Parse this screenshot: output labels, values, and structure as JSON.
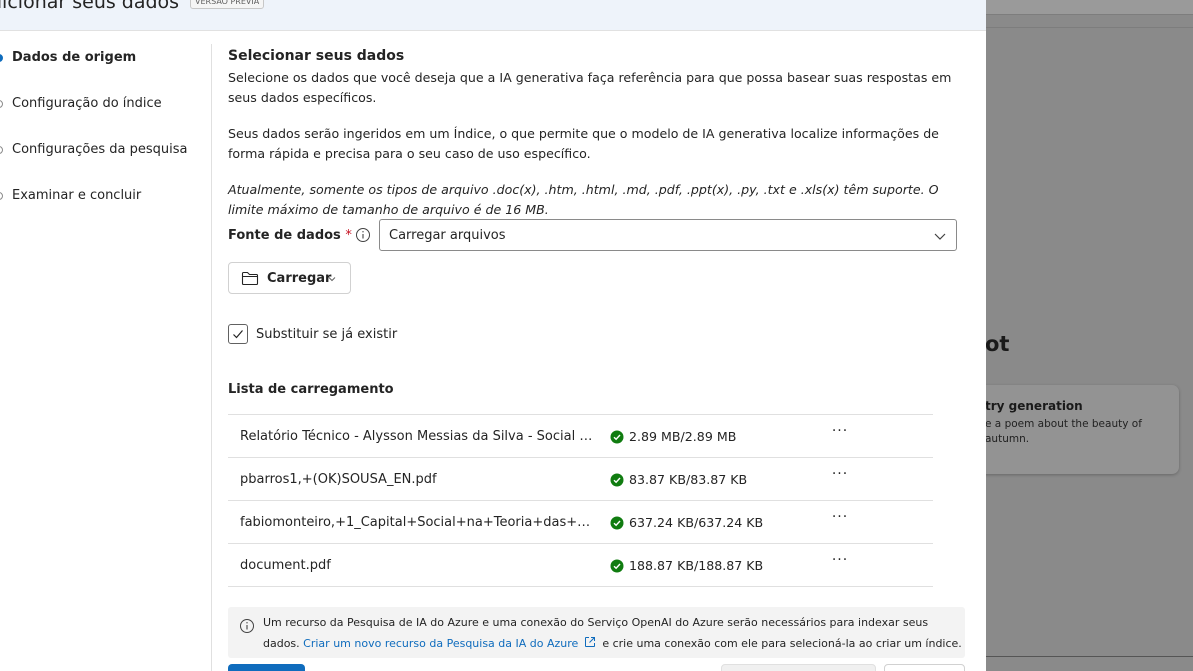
{
  "background": {
    "heading": "ot",
    "card": {
      "title": "try generation",
      "description": "e a poem about the beauty of autumn."
    }
  },
  "dialog": {
    "title": "dicionar seus dados",
    "badge": "VERSÃO PRÉVIA"
  },
  "steps": [
    {
      "label": "Dados de origem",
      "active": true
    },
    {
      "label": "Configuração do índice",
      "active": false
    },
    {
      "label": "Configurações da pesquisa",
      "active": false
    },
    {
      "label": "Examinar e concluir",
      "active": false
    }
  ],
  "content": {
    "title": "Selecionar seus dados",
    "para1": "Selecione os dados que você deseja que a IA generativa faça referência para que possa basear suas respostas em seus dados específicos.",
    "para2": "Seus dados serão ingeridos em um Índice, o que permite que o modelo de IA generativa localize informações de forma rápida e precisa para o seu caso de uso específico.",
    "para3": "Atualmente, somente os tipos de arquivo .doc(x), .htm, .html, .md, .pdf, .ppt(x), .py, .txt e .xls(x) têm suporte. O limite máximo de tamanho de arquivo é de 16 MB."
  },
  "data_source": {
    "label": "Fonte de dados",
    "required_mark": "*",
    "value": "Carregar arquivos"
  },
  "upload_button": {
    "label": "Carregar"
  },
  "overwrite_checkbox": {
    "label": "Substituir se já existir",
    "checked": true
  },
  "upload_list": {
    "title": "Lista de carregamento",
    "files": [
      {
        "name": "Relatório Técnico - Alysson Messias da Silva - Social Ne...",
        "size": "2.89 MB/2.89 MB",
        "status": "complete"
      },
      {
        "name": "pbarros1,+(OK)SOUSA_EN.pdf",
        "size": "83.87 KB/83.87 KB",
        "status": "complete"
      },
      {
        "name": "fabiomonteiro,+1_Capital+Social+na+Teoria+das+Red...",
        "size": "637.24 KB/637.24 KB",
        "status": "complete"
      },
      {
        "name": "document.pdf",
        "size": "188.87 KB/188.87 KB",
        "status": "complete"
      }
    ],
    "more_label": "···"
  },
  "notice": {
    "line1": "Um recurso da Pesquisa de IA do Azure e uma conexão do Serviço OpenAI do Azure serão necessários para indexar seus",
    "line2_prefix": "dados.",
    "link": "Criar um novo recurso da Pesquisa da IA do Azure",
    "line2_suffix": "e crie uma conexão com ele para selecioná-la ao criar um índice."
  },
  "colors": {
    "accent": "#0f6cbd",
    "success": "#107c10",
    "required": "#c50f1f"
  }
}
